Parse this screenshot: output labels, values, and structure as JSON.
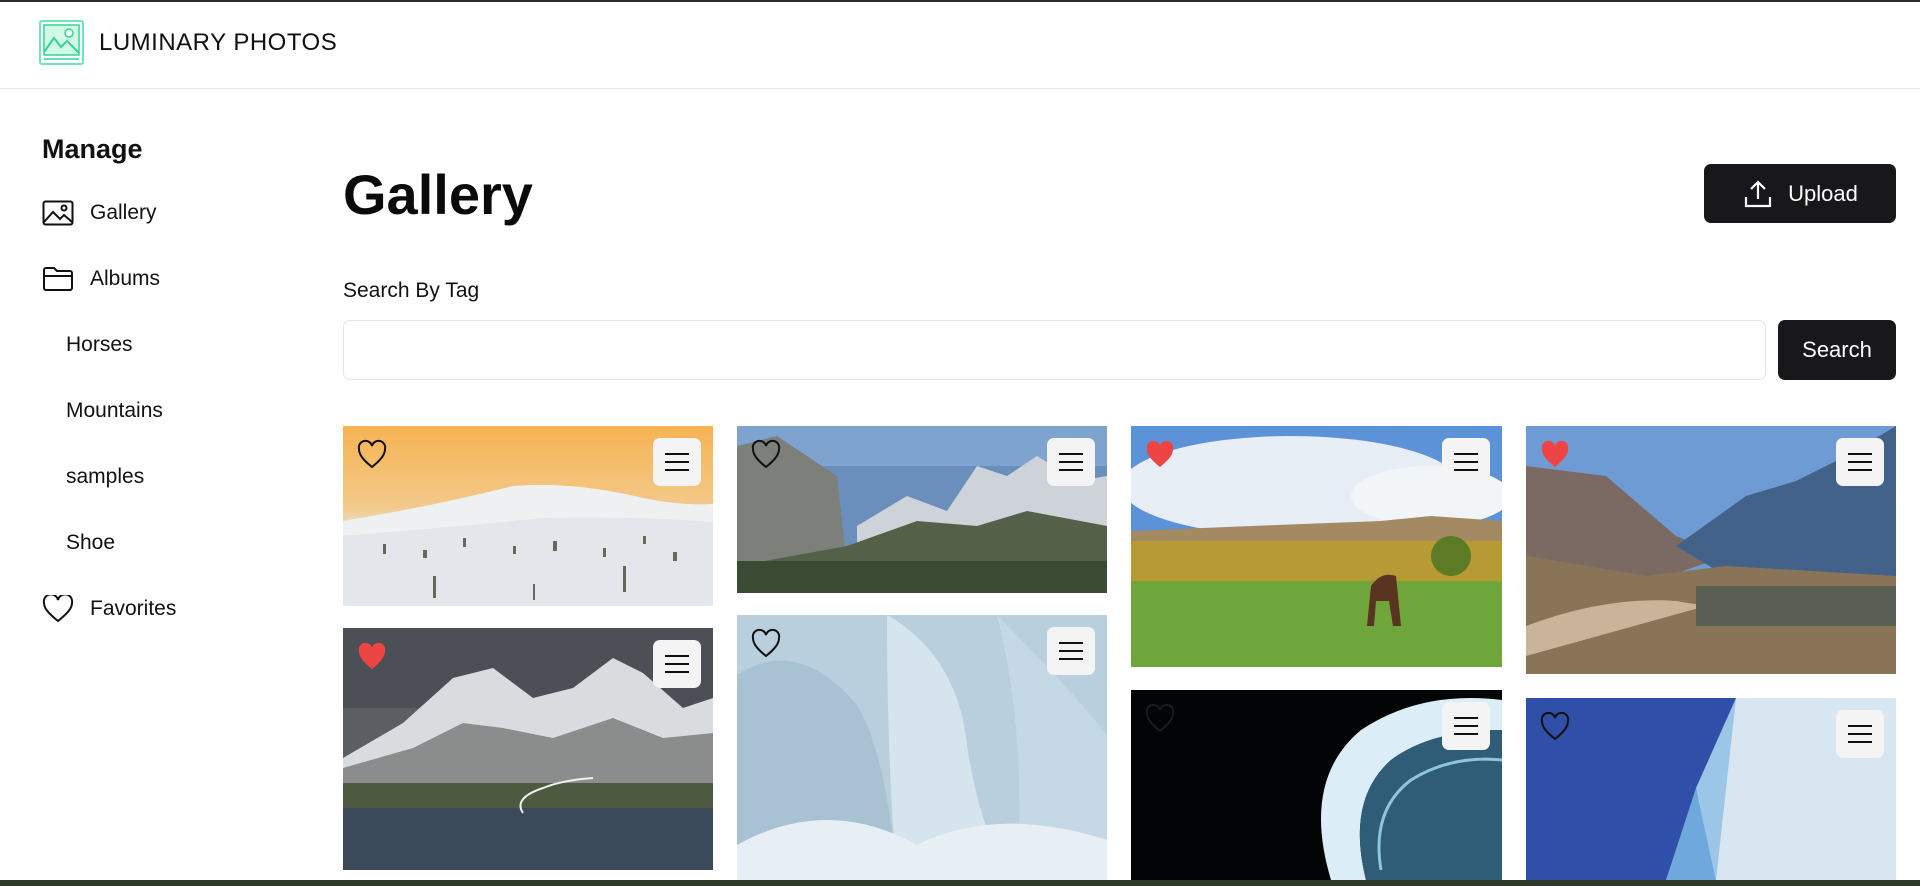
{
  "app": {
    "brand": "LUMINARY PHOTOS",
    "accent": "#18181b",
    "favorite_color": "#ef4444"
  },
  "sidebar": {
    "heading": "Manage",
    "items": [
      {
        "label": "Gallery",
        "icon": "image-icon"
      },
      {
        "label": "Albums",
        "icon": "folder-icon"
      }
    ],
    "albums": [
      "Horses",
      "Mountains",
      "samples",
      "Shoe"
    ],
    "favorites": {
      "label": "Favorites",
      "icon": "heart-icon"
    }
  },
  "main": {
    "title": "Gallery",
    "upload_label": "Upload",
    "search_label": "Search By Tag",
    "search_value": "",
    "search_button": "Search"
  },
  "photos": [
    {
      "subject": "desert-dunes",
      "favorite": false
    },
    {
      "subject": "mountain-valley",
      "favorite": false
    },
    {
      "subject": "horse-field",
      "favorite": true
    },
    {
      "subject": "mountain-village",
      "favorite": true
    },
    {
      "subject": "snowy-mountains-lake",
      "favorite": true
    },
    {
      "subject": "white-abstract",
      "favorite": false
    },
    {
      "subject": "neon-architecture",
      "favorite": false
    },
    {
      "subject": "blue-geometric",
      "favorite": false
    }
  ]
}
